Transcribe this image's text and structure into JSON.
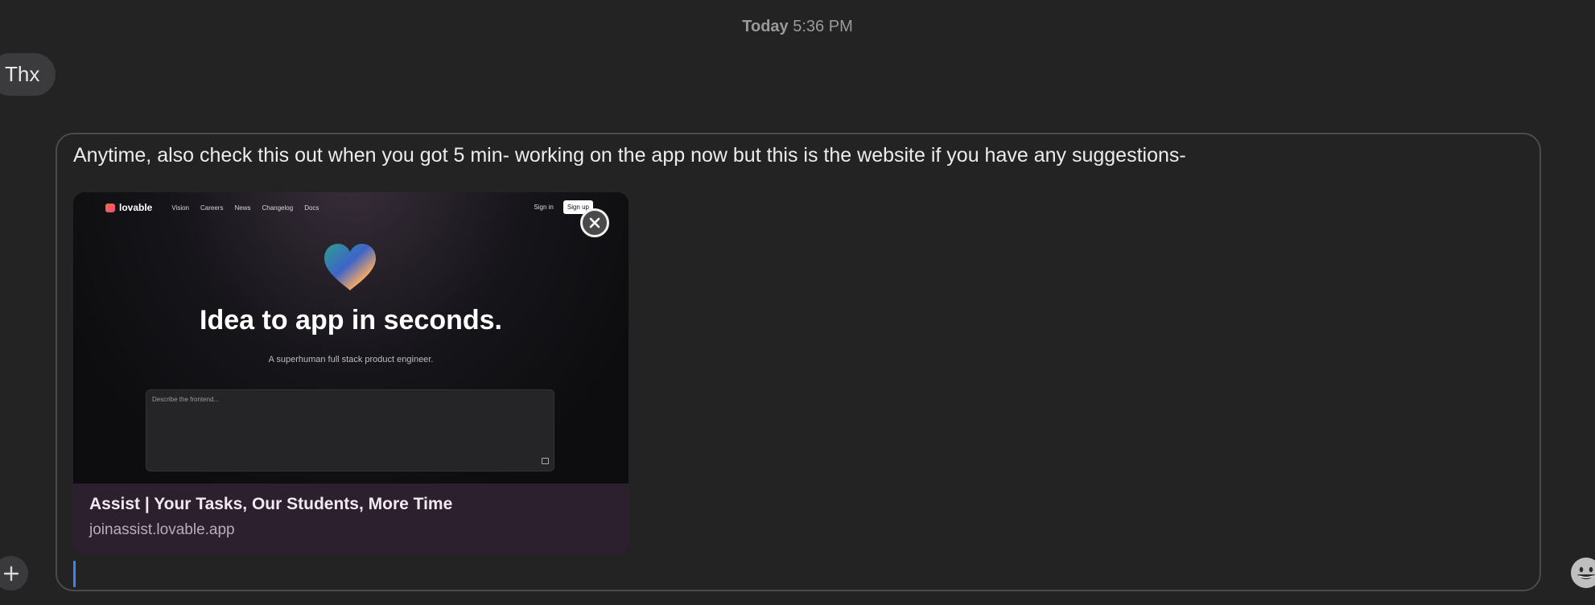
{
  "header": {
    "timestamp_day": "Today",
    "timestamp_time": "5:36 PM"
  },
  "messages": [
    {
      "text": "Thx"
    }
  ],
  "compose": {
    "text": "Anytime, also check this out when you got 5 min- working on the app now but this is the website if you have any suggestions-",
    "link_preview": {
      "site_nav": {
        "logo_text": "lovable",
        "links": [
          "Vision",
          "Careers",
          "News",
          "Changelog",
          "Docs"
        ],
        "sign_in": "Sign in",
        "sign_up": "Sign up"
      },
      "headline": "Idea to app in seconds.",
      "subheadline": "A superhuman full stack product engineer.",
      "input_placeholder": "Describe the frontend...",
      "title": "Assist | Your Tasks, Our Students, More Time",
      "url": "joinassist.lovable.app"
    }
  },
  "icons": {
    "close": "close-icon",
    "add": "plus-icon",
    "emoji": "emoji-icon"
  },
  "colors": {
    "background": "#232323",
    "bubble": "#3b3b3d",
    "caret": "#3b82f6",
    "card_footer": "#2c1f2e"
  }
}
